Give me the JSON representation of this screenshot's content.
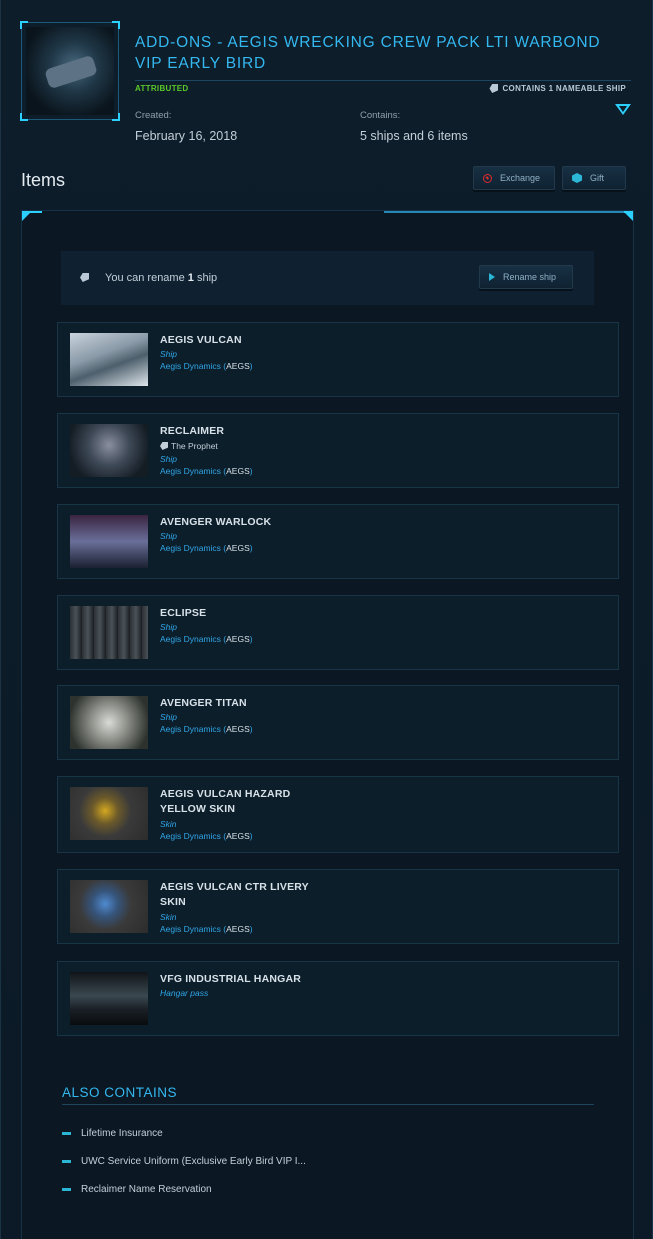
{
  "header": {
    "title": "ADD-ONS - AEGIS WRECKING CREW PACK LTI WARBOND VIP EARLY BIRD",
    "status": "ATTRIBUTED",
    "nameable_badge": "CONTAINS 1 NAMEABLE SHIP",
    "created_label": "Created:",
    "created_value": "February 16, 2018",
    "contains_label": "Contains:",
    "contains_value": "5 ships and 6 items"
  },
  "items_section": {
    "heading": "Items",
    "exchange_label": "Exchange",
    "gift_label": "Gift",
    "rename_text_prefix": "You can rename ",
    "rename_count": "1",
    "rename_text_suffix": " ship",
    "rename_button": "Rename ship"
  },
  "items": [
    {
      "name": "AEGIS VULCAN",
      "custom_name": "",
      "type": "Ship",
      "manufacturer": "Aegis Dynamics",
      "code": "AEGS"
    },
    {
      "name": "RECLAIMER",
      "custom_name": "The Prophet",
      "type": "Ship",
      "manufacturer": "Aegis Dynamics",
      "code": "AEGS"
    },
    {
      "name": "AVENGER WARLOCK",
      "custom_name": "",
      "type": "Ship",
      "manufacturer": "Aegis Dynamics",
      "code": "AEGS"
    },
    {
      "name": "ECLIPSE",
      "custom_name": "",
      "type": "Ship",
      "manufacturer": "Aegis Dynamics",
      "code": "AEGS"
    },
    {
      "name": "AVENGER TITAN",
      "custom_name": "",
      "type": "Ship",
      "manufacturer": "Aegis Dynamics",
      "code": "AEGS"
    },
    {
      "name": "AEGIS VULCAN HAZARD YELLOW SKIN",
      "custom_name": "",
      "type": "Skin",
      "manufacturer": "Aegis Dynamics",
      "code": "AEGS"
    },
    {
      "name": "AEGIS VULCAN CTR LIVERY SKIN",
      "custom_name": "",
      "type": "Skin",
      "manufacturer": "Aegis Dynamics",
      "code": "AEGS"
    },
    {
      "name": "VFG INDUSTRIAL HANGAR",
      "custom_name": "",
      "type": "Hangar pass",
      "manufacturer": "",
      "code": ""
    }
  ],
  "also_contains": {
    "title": "ALSO CONTAINS",
    "items": [
      "Lifetime Insurance",
      "UWC Service Uniform (Exclusive Early Bird VIP I...",
      "Reclaimer Name Reservation"
    ]
  },
  "colors": {
    "accent": "#34b8f0",
    "status_green": "#5bc82a",
    "background": "#0b1a26"
  }
}
